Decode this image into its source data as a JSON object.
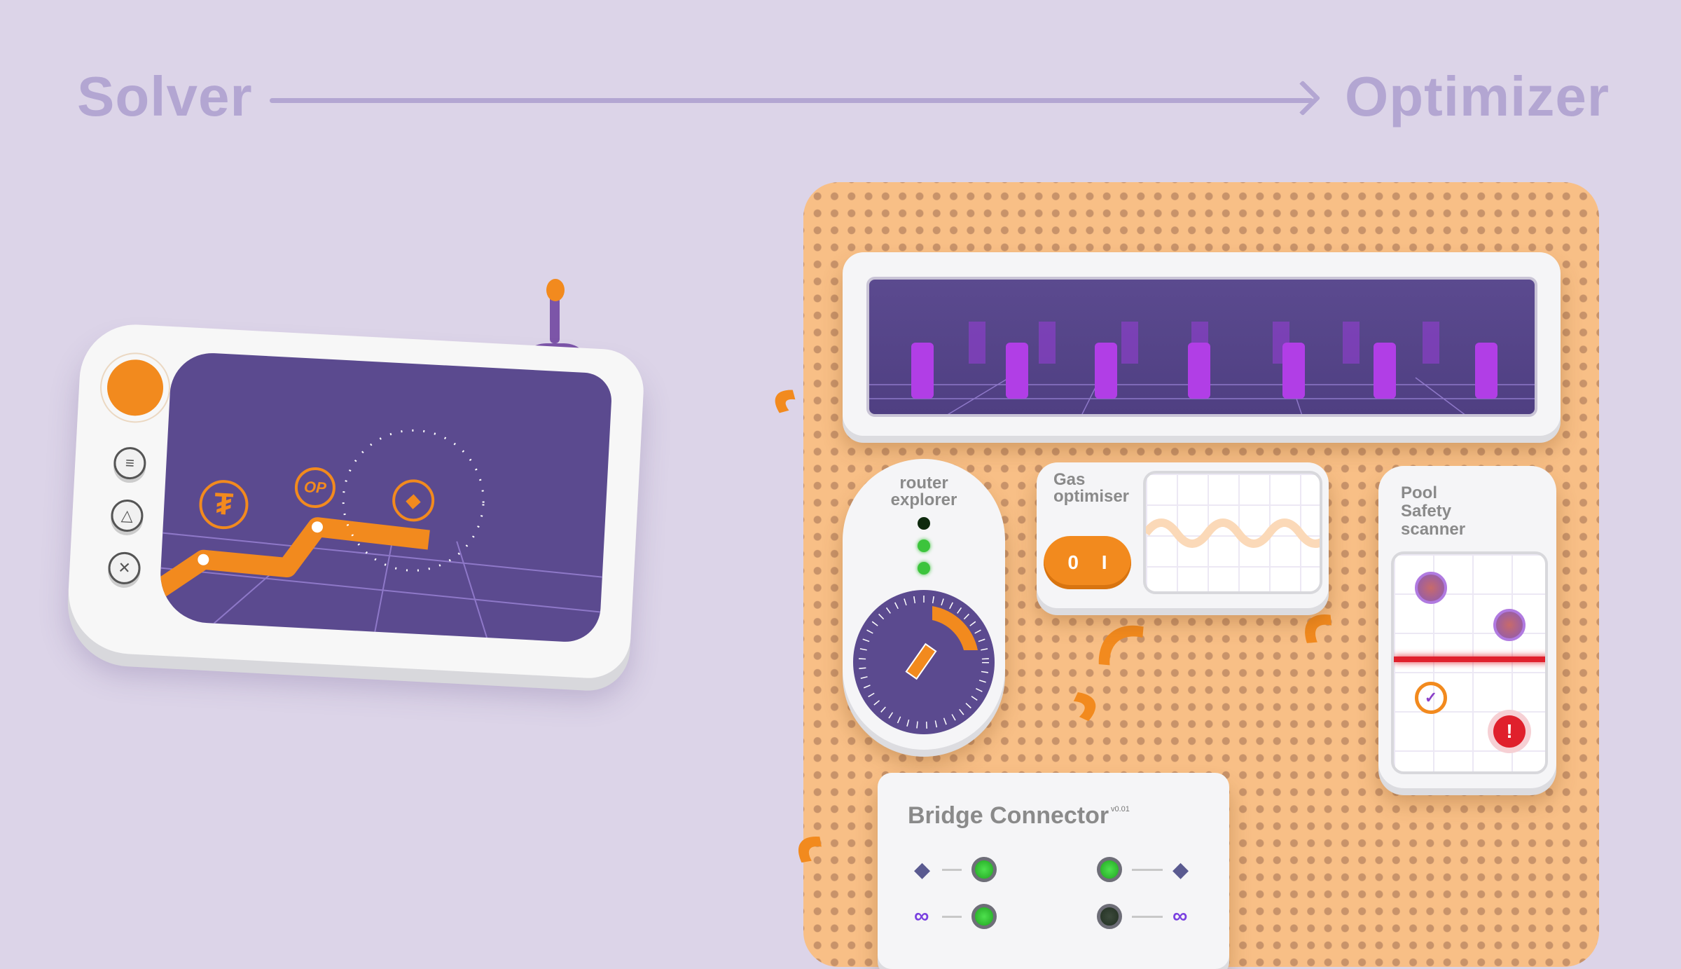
{
  "header": {
    "left_title": "Solver",
    "right_title": "Optimizer"
  },
  "solver_device": {
    "buttons": [
      {
        "icon": "menu-icon",
        "glyph": "≡"
      },
      {
        "icon": "triangle-icon",
        "glyph": "△"
      },
      {
        "icon": "close-icon",
        "glyph": "✕"
      }
    ],
    "route_tokens": [
      {
        "icon": "tether-icon",
        "label": "₮"
      },
      {
        "icon": "optimism-icon",
        "label": "OP"
      },
      {
        "icon": "ethereum-icon",
        "label": "◆"
      }
    ]
  },
  "optimizer": {
    "router_explorer": {
      "title_line1": "router",
      "title_line2": "explorer",
      "leds": [
        "off",
        "on",
        "on"
      ]
    },
    "gas_optimiser": {
      "title_line1": "Gas",
      "title_line2": "optimiser",
      "toggle_left": "0",
      "toggle_right": "I"
    },
    "pool_scanner": {
      "title_line1": "Pool",
      "title_line2": "Safety",
      "title_line3": "scanner",
      "alert_glyph": "!",
      "check_glyph": "✓"
    },
    "bridge_connector": {
      "title": "Bridge Connector",
      "version": "v0.01",
      "rows": [
        {
          "left_icon": "ethereum-icon",
          "left_glyph": "◆",
          "left_led": "on",
          "right_led": "on",
          "right_icon": "ethereum-icon",
          "right_glyph": "◆"
        },
        {
          "left_icon": "polygon-icon",
          "left_glyph": "∞",
          "left_led": "on",
          "right_led": "off",
          "right_icon": "polygon-icon",
          "right_glyph": "∞"
        }
      ]
    }
  },
  "colors": {
    "accent": "#f28a1e",
    "purple": "#5b4a8f",
    "pegboard": "#f8bf86",
    "background": "#dcd4e8",
    "alert": "#e0202c",
    "led_on": "#2fc22f",
    "led_off": "#2c3a2c"
  }
}
